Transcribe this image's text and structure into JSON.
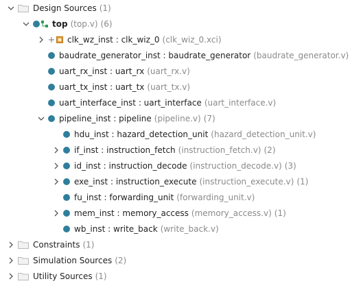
{
  "tree": {
    "design_sources": {
      "label": "Design Sources",
      "count": "(1)"
    },
    "top": {
      "label": "top",
      "file": "(top.v)",
      "count": "(6)"
    },
    "clk_wz_inst": {
      "label": "clk_wz_inst : clk_wiz_0",
      "file": "(clk_wiz_0.xci)"
    },
    "baudrate": {
      "label": "baudrate_generator_inst : baudrate_generator",
      "file": "(baudrate_generator.v)"
    },
    "uart_rx": {
      "label": "uart_rx_inst : uart_rx",
      "file": "(uart_rx.v)"
    },
    "uart_tx": {
      "label": "uart_tx_inst : uart_tx",
      "file": "(uart_tx.v)"
    },
    "uart_interface": {
      "label": "uart_interface_inst : uart_interface",
      "file": "(uart_interface.v)"
    },
    "pipeline": {
      "label": "pipeline_inst : pipeline",
      "file": "(pipeline.v)",
      "count": "(7)"
    },
    "hdu": {
      "label": "hdu_inst : hazard_detection_unit",
      "file": "(hazard_detection_unit.v)"
    },
    "if_inst": {
      "label": "if_inst : instruction_fetch",
      "file": "(instruction_fetch.v)",
      "count": "(2)"
    },
    "id_inst": {
      "label": "id_inst : instruction_decode",
      "file": "(instruction_decode.v)",
      "count": "(3)"
    },
    "exe_inst": {
      "label": "exe_inst : instruction_execute",
      "file": "(instruction_execute.v)",
      "count": "(1)"
    },
    "fu_inst": {
      "label": "fu_inst : forwarding_unit",
      "file": "(forwarding_unit.v)"
    },
    "mem_inst": {
      "label": "mem_inst : memory_access",
      "file": "(memory_access.v)",
      "count": "(1)"
    },
    "wb_inst": {
      "label": "wb_inst : write_back",
      "file": "(write_back.v)"
    },
    "constraints": {
      "label": "Constraints",
      "count": "(1)"
    },
    "simulation_sources": {
      "label": "Simulation Sources",
      "count": "(2)"
    },
    "utility_sources": {
      "label": "Utility Sources",
      "count": "(1)"
    }
  },
  "colors": {
    "module_dot": "#2f7f9c",
    "folder": "#b9b9b9",
    "meta_text": "#8a8a8a",
    "ip_icon": "#e8a13a"
  },
  "icons": {
    "expanded": "chevron-down-icon",
    "collapsed": "chevron-right-icon",
    "folder": "folder-icon",
    "module": "module-dot-icon",
    "hierarchy": "hierarchy-icon",
    "ip": "ip-core-icon"
  }
}
